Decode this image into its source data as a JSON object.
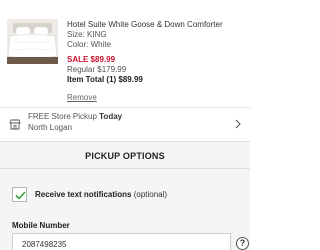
{
  "item": {
    "title": "Hotel Suite White Goose & Down Comforter",
    "size": "Size: KING",
    "color": "Color: White",
    "sale": "SALE $89.99",
    "regular": "Regular $179.99",
    "total": "Item Total (1) $89.99",
    "remove_label": "Remove",
    "image_icon": "comforter-bed-photo"
  },
  "pickup": {
    "prefix": "FREE Store Pickup ",
    "day": "Today",
    "store": "North Logan",
    "store_icon": "store-icon",
    "chevron_icon": "chevron-right-icon"
  },
  "options": {
    "heading": "PICKUP OPTIONS",
    "notif_label": "Receive text notifications",
    "notif_optional": " (optional)",
    "notif_checked": true,
    "mobile_label": "Mobile Number",
    "mobile_value": "2087498235",
    "help_icon": "?"
  },
  "colors": {
    "sale": "#c8102e",
    "check": "#3a9a3a",
    "options_bg": "#f5f5f5"
  }
}
